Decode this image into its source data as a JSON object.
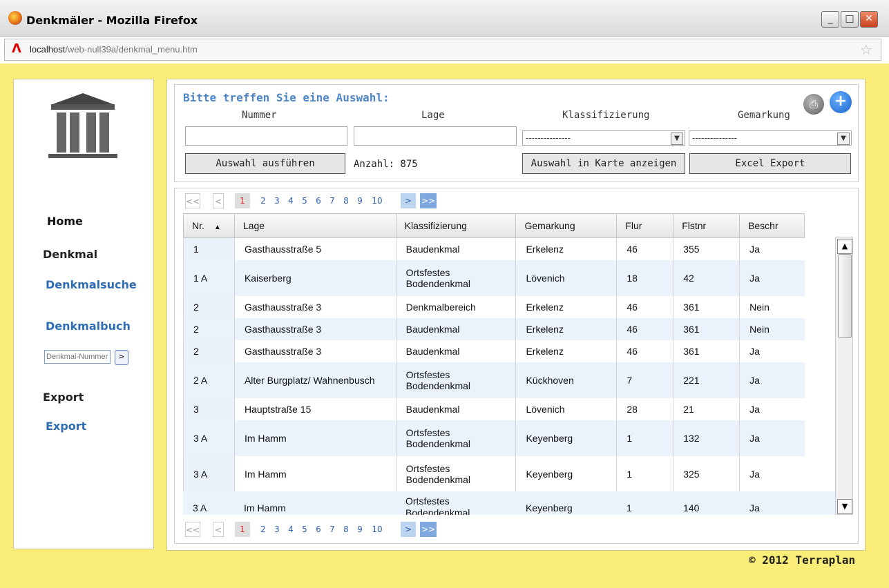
{
  "window": {
    "title": "Denkmäler - Mozilla Firefox",
    "url_host": "localhost",
    "url_path": "/web-null39a/denkmal_menu.htm"
  },
  "sidebar": {
    "items": [
      {
        "label": "Home"
      },
      {
        "label": "Denkmal"
      },
      {
        "label": "Denkmalsuche"
      },
      {
        "label": "Denkmalbuch"
      }
    ],
    "denkmal_nr_placeholder": "Denkmal-Nummer",
    "go_label": ">",
    "export_heading": "Export",
    "export_link": "Export"
  },
  "filter": {
    "heading": "Bitte treffen Sie eine Auswahl:",
    "labels": {
      "nummer": "Nummer",
      "lage": "Lage",
      "klassifizierung": "Klassifizierung",
      "gemarkung": "Gemarkung"
    },
    "klassifizierung_value": "---------------",
    "gemarkung_value": "---------------",
    "run_button": "Auswahl ausführen",
    "count": "Anzahl: 875",
    "map_button": "Auswahl in Karte anzeigen",
    "excel_button": "Excel Export"
  },
  "pager": {
    "first": "<<",
    "prev": "<",
    "pages": [
      "1",
      "2",
      "3",
      "4",
      "5",
      "6",
      "7",
      "8",
      "9",
      "10"
    ],
    "next": ">",
    "last": ">>"
  },
  "table": {
    "columns": [
      "Nr.",
      "Lage",
      "Klassifizierung",
      "Gemarkung",
      "Flur",
      "Flstnr",
      "Beschr"
    ],
    "rows": [
      {
        "nr": "1",
        "lage": "Gasthausstraße 5",
        "klass": "Baudenkmal",
        "gem": "Erkelenz",
        "flur": "46",
        "flst": "355",
        "beschr": "Ja"
      },
      {
        "nr": "1 A",
        "lage": "Kaiserberg",
        "klass": "Ortsfestes Bodendenkmal",
        "gem": "Lövenich",
        "flur": "18",
        "flst": "42",
        "beschr": "Ja"
      },
      {
        "nr": "2",
        "lage": "Gasthausstraße 3",
        "klass": "Denkmalbereich",
        "gem": "Erkelenz",
        "flur": "46",
        "flst": "361",
        "beschr": "Nein"
      },
      {
        "nr": "2",
        "lage": "Gasthausstraße 3",
        "klass": "Baudenkmal",
        "gem": "Erkelenz",
        "flur": "46",
        "flst": "361",
        "beschr": "Nein"
      },
      {
        "nr": "2",
        "lage": "Gasthausstraße 3",
        "klass": "Baudenkmal",
        "gem": "Erkelenz",
        "flur": "46",
        "flst": "361",
        "beschr": "Ja"
      },
      {
        "nr": "2 A",
        "lage": "Alter Burgplatz/ Wahnenbusch",
        "klass": "Ortsfestes Bodendenkmal",
        "gem": "Kückhoven",
        "flur": "7",
        "flst": "221",
        "beschr": "Ja"
      },
      {
        "nr": "3",
        "lage": "Hauptstraße 15",
        "klass": "Baudenkmal",
        "gem": "Lövenich",
        "flur": "28",
        "flst": "21",
        "beschr": "Ja"
      },
      {
        "nr": "3 A",
        "lage": "Im Hamm",
        "klass": "Ortsfestes Bodendenkmal",
        "gem": "Keyenberg",
        "flur": "1",
        "flst": "132",
        "beschr": "Ja"
      },
      {
        "nr": "3 A",
        "lage": "Im Hamm",
        "klass": "Ortsfestes Bodendenkmal",
        "gem": "Keyenberg",
        "flur": "1",
        "flst": "325",
        "beschr": "Ja"
      },
      {
        "nr": "3 A",
        "lage": "Im Hamm",
        "klass": "Ortsfestes Bodendenkmal",
        "gem": "Keyenberg",
        "flur": "1",
        "flst": "140",
        "beschr": "Ja"
      }
    ]
  },
  "footer": {
    "copyright": "© 2012 Terraplan"
  },
  "colors": {
    "page_bg": "#fbee78",
    "link": "#2e6db4",
    "row_alt": "#eaf3fc",
    "active_page": "#e03030"
  }
}
